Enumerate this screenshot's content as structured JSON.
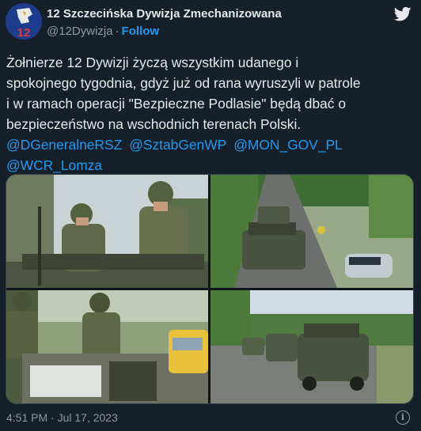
{
  "account": {
    "display_name": "12 Szczecińska Dywizja Zmechanizowana",
    "handle": "@12Dywizja",
    "separator": "·",
    "follow_label": "Follow",
    "avatar_text": "12"
  },
  "tweet": {
    "lines": [
      "Żołnierze 12 Dywizji życzą wszystkim udanego i",
      "spokojnego tygodnia, gdyż już od rana wyruszyli w patrole",
      "i w ramach operacji \"Bezpieczne Podlasie\" będą dbać o",
      "bezpieczeństwo na wschodnich terenach Polski."
    ],
    "mentions": [
      "@DGeneralneRSZ",
      "@SztabGenWP",
      "@MON_GOV_PL",
      "@WCR_Lomza"
    ]
  },
  "footer": {
    "timestamp": "4:51 PM · Jul 17, 2023",
    "info_glyph": "i"
  },
  "colors": {
    "background": "#15202b",
    "text": "#e7e9ea",
    "muted": "#8b98a5",
    "accent": "#1d9bf0"
  },
  "icons": {
    "logo": "twitter-bird-icon",
    "info": "info-icon"
  }
}
